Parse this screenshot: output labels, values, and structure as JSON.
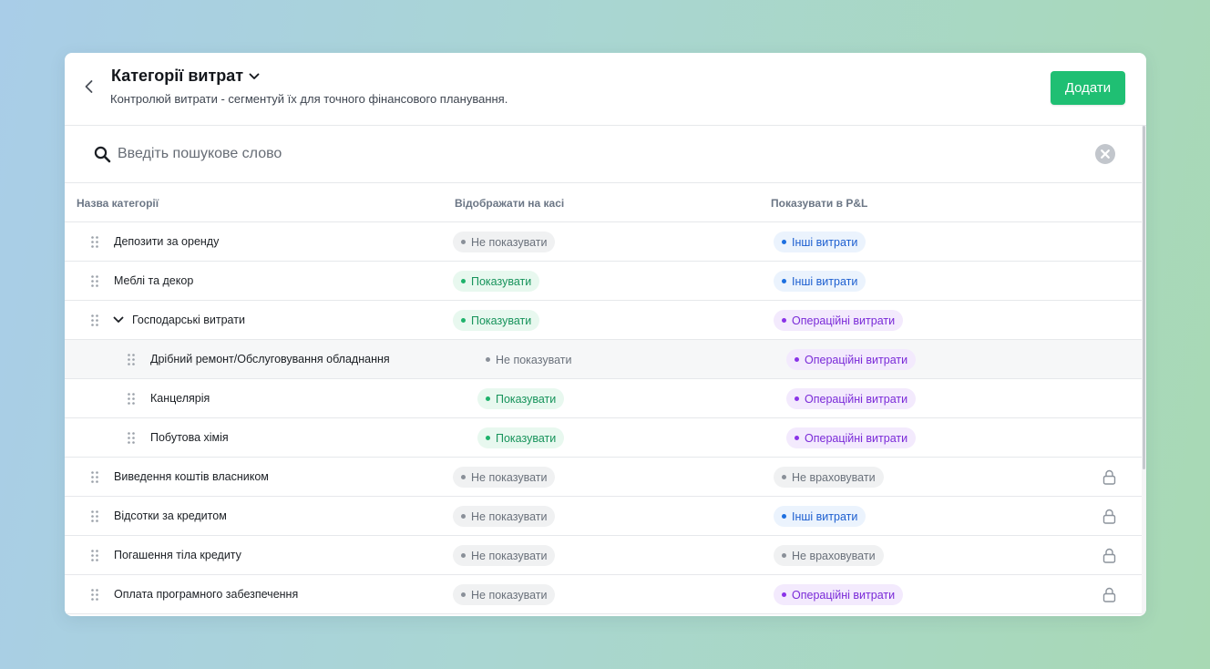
{
  "header": {
    "title": "Категорії витрат",
    "subtitle": "Контролюй витрати - сегментуй їх для точного фінансового планування.",
    "add_label": "Додати"
  },
  "search": {
    "placeholder": "Введіть пошукове слово",
    "value": ""
  },
  "table": {
    "columns": [
      "Назва категорії",
      "Відображати на касі",
      "Показувати в P&L"
    ],
    "rows": [
      {
        "name": "Депозити за оренду",
        "cash": "Не показувати",
        "pl": "Інші витрати",
        "level": 0,
        "locked": false
      },
      {
        "name": "Меблі та декор",
        "cash": "Показувати",
        "pl": "Інші витрати",
        "level": 0,
        "locked": false
      },
      {
        "name": "Господарські витрати",
        "cash": "Показувати",
        "pl": "Операційні витрати",
        "level": 0,
        "expanded": true,
        "locked": false
      },
      {
        "name": "Дрібний ремонт/Обслуговування обладнання",
        "cash": "Не показувати",
        "pl": "Операційні витрати",
        "level": 1,
        "locked": false,
        "hovered": true
      },
      {
        "name": "Канцелярія",
        "cash": "Показувати",
        "pl": "Операційні витрати",
        "level": 1,
        "locked": false
      },
      {
        "name": "Побутова хімія",
        "cash": "Показувати",
        "pl": "Операційні витрати",
        "level": 1,
        "locked": false
      },
      {
        "name": "Виведення коштів власником",
        "cash": "Не показувати",
        "pl": "Не враховувати",
        "level": 0,
        "locked": true
      },
      {
        "name": "Відсотки за кредитом",
        "cash": "Не показувати",
        "pl": "Інші витрати",
        "level": 0,
        "locked": true
      },
      {
        "name": "Погашення тіла кредиту",
        "cash": "Не показувати",
        "pl": "Не враховувати",
        "level": 0,
        "locked": true
      },
      {
        "name": "Оплата програмного забезпечення",
        "cash": "Не показувати",
        "pl": "Операційні витрати",
        "level": 0,
        "locked": true
      }
    ]
  },
  "icons": {
    "back": "chevron-left-icon",
    "title_dropdown": "chevron-down-icon",
    "search": "search-icon",
    "clear": "close-circle-icon",
    "drag": "drag-handle-icon",
    "expand": "chevron-down-icon",
    "lock": "lock-icon"
  },
  "colors": {
    "accent": "#1fbf73",
    "show": "#17935b",
    "other_expenses": "#1d5fd0",
    "operating_expenses": "#7a2ad8",
    "muted": "#6a717b"
  }
}
